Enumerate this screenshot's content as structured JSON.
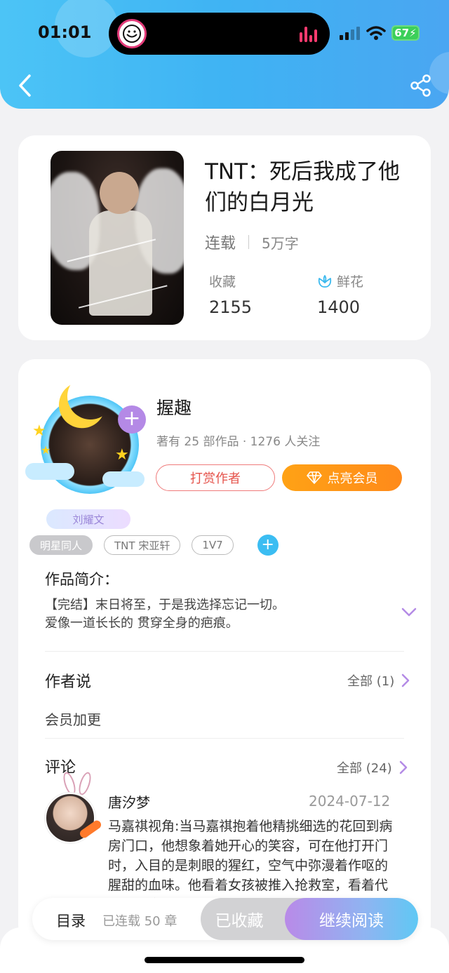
{
  "status_bar": {
    "time": "01:01",
    "battery": "67"
  },
  "book": {
    "title": "TNT：死后我成了他们的白月光",
    "status": "连载",
    "word_count": "5万字",
    "favorites_label": "收藏",
    "favorites_count": "2155",
    "flowers_label": "鲜花",
    "flowers_count": "1400",
    "cover_icon": "book-cover-image"
  },
  "author": {
    "name": "握趣",
    "meta": "著有 25 部作品 · 1276 人关注",
    "badge": "刘耀文",
    "reward_button": "打赏作者",
    "vip_button": "点亮会员"
  },
  "tags": [
    "明星同人",
    "TNT 宋亚轩",
    "1V7"
  ],
  "intro": {
    "title": "作品简介：",
    "text_line1": "【完结】末日将至，于是我选择忘记一切。",
    "text_line2": "爱像一道长长的 贯穿全身的疤痕。"
  },
  "author_says": {
    "title": "作者说",
    "all_label": "全部 (1)",
    "content": "会员加更"
  },
  "comments": {
    "title": "评论",
    "all_label": "全部 (24)",
    "items": [
      {
        "name": "唐汐梦",
        "date": "2024-07-12",
        "text": "马嘉祺视角:当马嘉祺抱着他精挑细选的花回到病房门口，他想象着她开心的笑容，可在他打开门时，入目的是刺眼的猩红，空气中弥漫着作呕的腥甜的血味。他看着女孩被推入抢救室，看着代表她生命的绿灯熄灭，他"
      }
    ]
  },
  "bottom_bar": {
    "toc": "目录",
    "serial": "已连载 50 章",
    "collected": "已收藏",
    "continue": "继续阅读"
  },
  "colors": {
    "header": "#3fb3f3",
    "reward": "#e5534b",
    "vip": "#ff8a1a",
    "accent_purple": "#b489e6"
  }
}
